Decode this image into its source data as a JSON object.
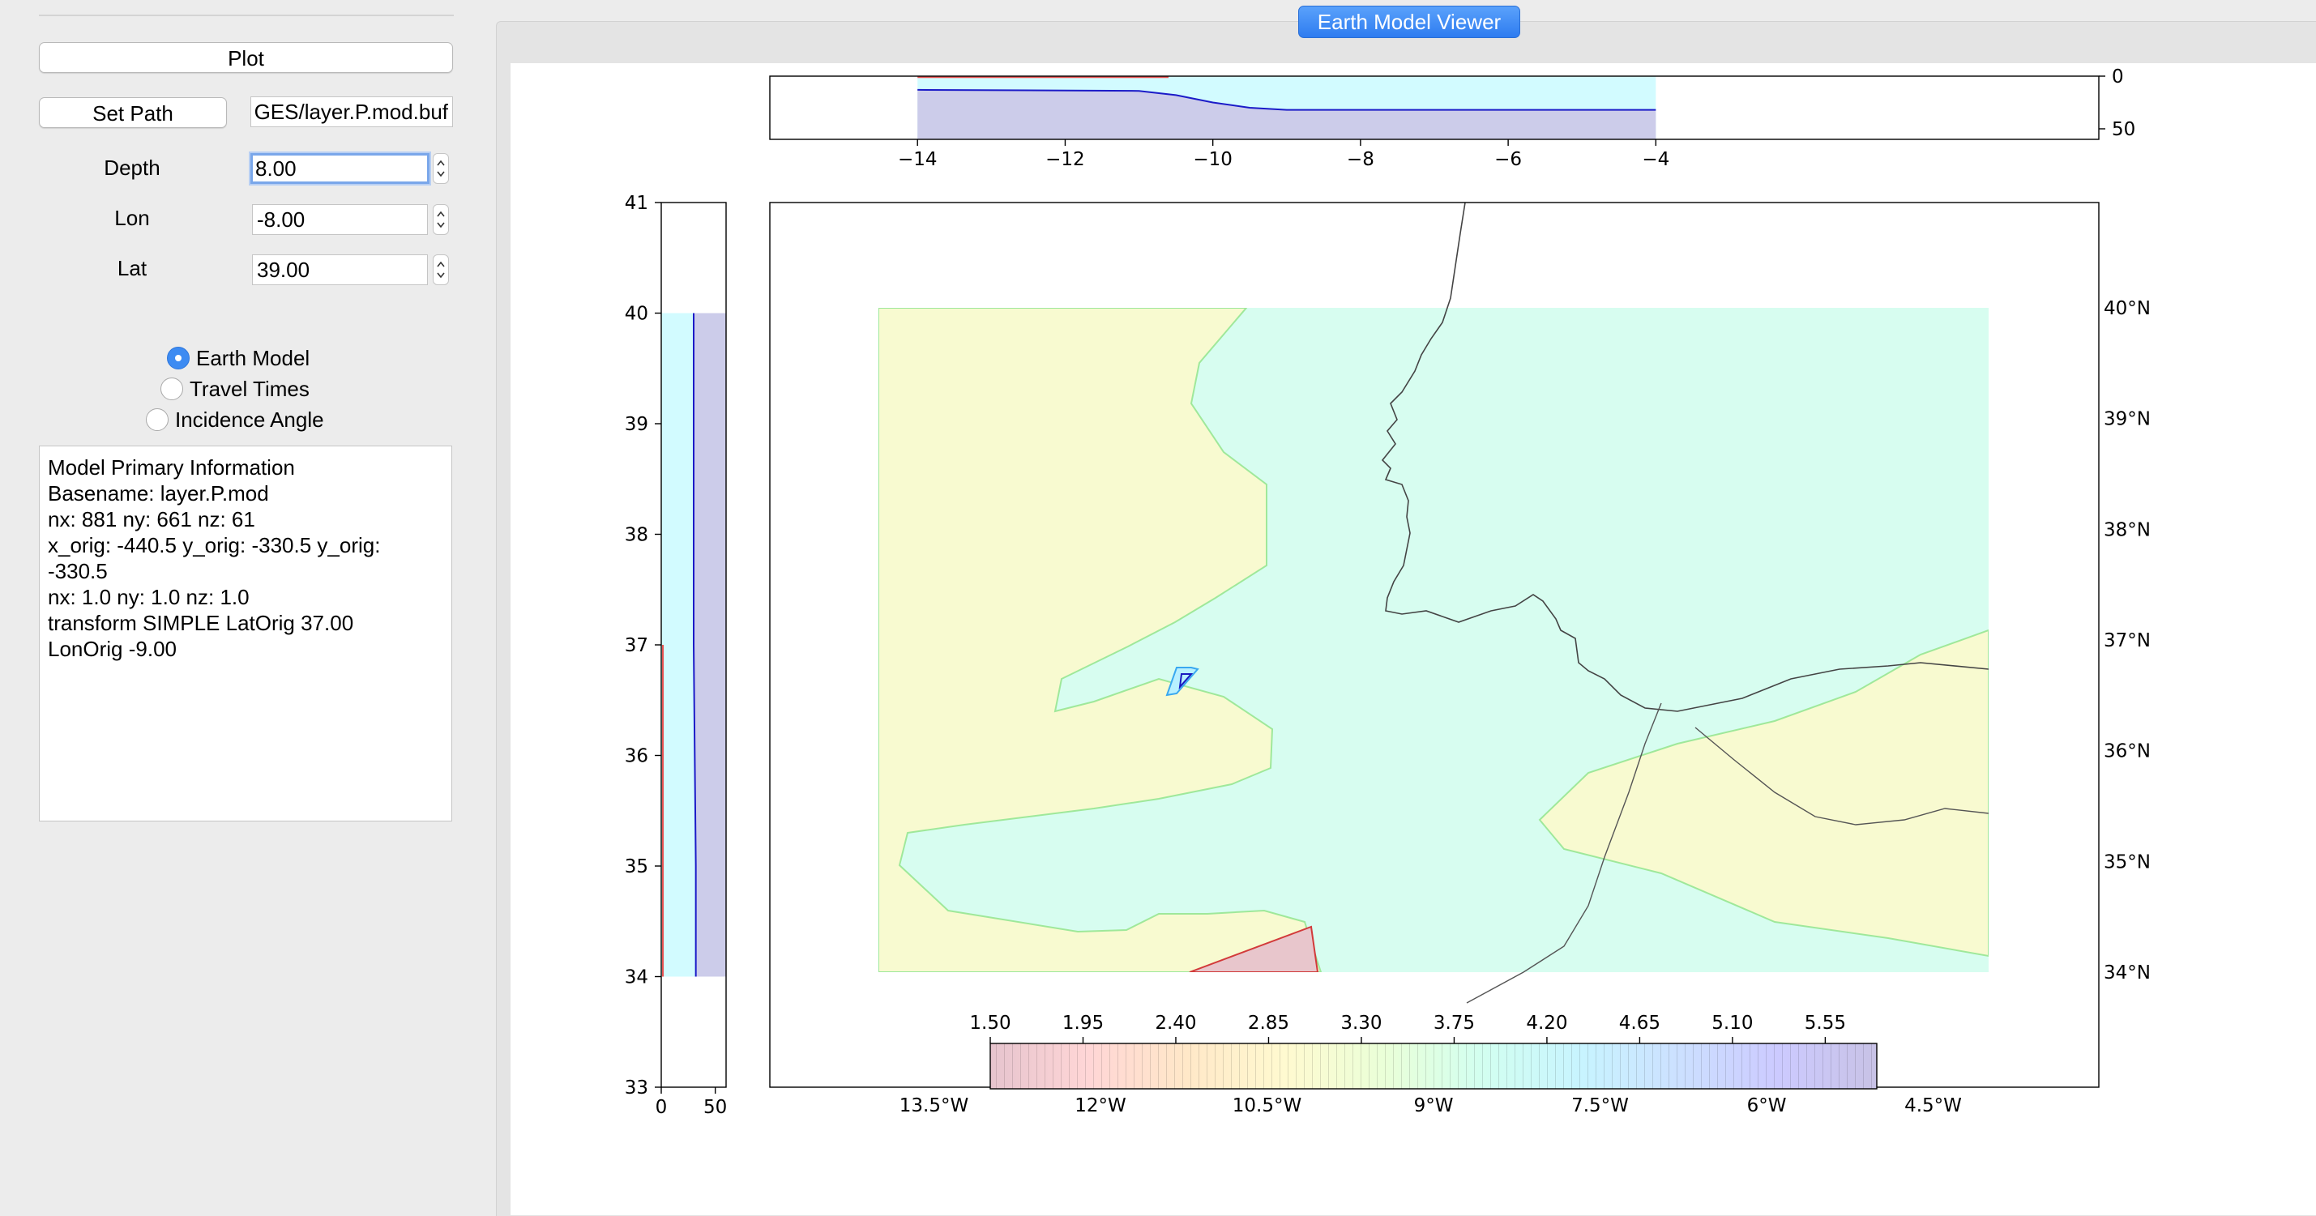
{
  "window": {
    "title": "Earth Model Viewer"
  },
  "controls": {
    "plot_label": "Plot",
    "set_path_label": "Set Path",
    "path_value": "GES/layer.P.mod.buf",
    "depth_label": "Depth",
    "depth_value": "8.00",
    "lon_label": "Lon",
    "lon_value": "-8.00",
    "lat_label": "Lat",
    "lat_value": "39.00"
  },
  "modes": {
    "selected": "Earth Model",
    "options": [
      "Earth Model",
      "Travel Times",
      "Incidence Angle"
    ]
  },
  "info": {
    "lines": [
      "Model Primary Information",
      "Basename: layer.P.mod",
      "nx: 881 ny: 661 nz: 61",
      "x_orig: -440.5 y_orig: -330.5 y_orig:",
      "-330.5",
      "nx: 1.0 ny: 1.0 nz: 1.0",
      "transform SIMPLE LatOrig 37.00",
      "LonOrig -9.00"
    ]
  },
  "chart_data": [
    {
      "type": "area",
      "name_hint": "depth cross-section along longitude",
      "x_ticks": [
        "−14",
        "−12",
        "−10",
        "−8",
        "−6",
        "−4"
      ],
      "x_tick_values": [
        -14,
        -12,
        -10,
        -8,
        -6,
        -4
      ],
      "y_ticks": [
        "0",
        "50"
      ],
      "y_tick_values": [
        0,
        50
      ],
      "xlim": [
        -16,
        2
      ],
      "ylim": [
        0,
        60
      ],
      "boundary_x": [
        -14,
        -11,
        -10.5,
        -10,
        -9.5,
        -9,
        -4
      ],
      "boundary_depth": [
        13,
        14,
        18,
        25,
        30,
        32,
        32
      ],
      "fill_color": "#ccccea",
      "line_color": "#1b1bc8"
    },
    {
      "type": "area",
      "name_hint": "depth profile along latitude",
      "y_ticks": [
        "33",
        "34",
        "35",
        "36",
        "37",
        "38",
        "39",
        "40",
        "41"
      ],
      "y_tick_values": [
        33,
        34,
        35,
        36,
        37,
        38,
        39,
        40,
        41
      ],
      "x_ticks": [
        "0",
        "50"
      ],
      "x_tick_values": [
        0,
        50
      ],
      "ylim": [
        33,
        41
      ],
      "xlim": [
        0,
        60
      ],
      "profile_lat": [
        34,
        35,
        36,
        37,
        38,
        39,
        40
      ],
      "profile_depth": [
        32,
        32,
        31,
        30,
        30,
        30,
        30
      ],
      "fill_color": "#ccccea",
      "line_color": "#1b1bc8"
    },
    {
      "type": "heatmap",
      "name_hint": "velocity map at depth",
      "lon_ticks": [
        "13.5°W",
        "12°W",
        "10.5°W",
        "9°W",
        "7.5°W",
        "6°W",
        "4.5°W"
      ],
      "lon_tick_values": [
        -13.5,
        -12,
        -10.5,
        -9,
        -7.5,
        -6,
        -4.5
      ],
      "lat_ticks": [
        "34°N",
        "35°N",
        "36°N",
        "37°N",
        "38°N",
        "39°N",
        "40°N"
      ],
      "lat_tick_values": [
        34,
        35,
        36,
        37,
        38,
        39,
        40
      ],
      "xlim": [
        -14,
        -4
      ],
      "ylim": [
        33,
        41
      ],
      "data_extent": {
        "lon": [
          -14,
          -4
        ],
        "lat": [
          34,
          40
        ]
      },
      "colors": {
        "base": "#d7fdf0",
        "low_zone": "#f8fad0",
        "zero_zone": "#e8c6cc",
        "coast": "#444444"
      }
    },
    {
      "type": "bar",
      "name_hint": "colorbar",
      "ticks": [
        "1.50",
        "1.95",
        "2.40",
        "2.85",
        "3.30",
        "3.75",
        "4.20",
        "4.65",
        "5.10",
        "5.55"
      ],
      "tick_values": [
        1.5,
        1.95,
        2.4,
        2.85,
        3.3,
        3.75,
        4.2,
        4.65,
        5.1,
        5.55
      ],
      "range": [
        1.5,
        5.8
      ],
      "stops": [
        "#e6c4ce",
        "#ffd6d6",
        "#ffe8c8",
        "#fffad0",
        "#eaffd8",
        "#d2fff0",
        "#c8f4ff",
        "#cce0ff",
        "#cccaff",
        "#c8c2e6"
      ]
    }
  ]
}
